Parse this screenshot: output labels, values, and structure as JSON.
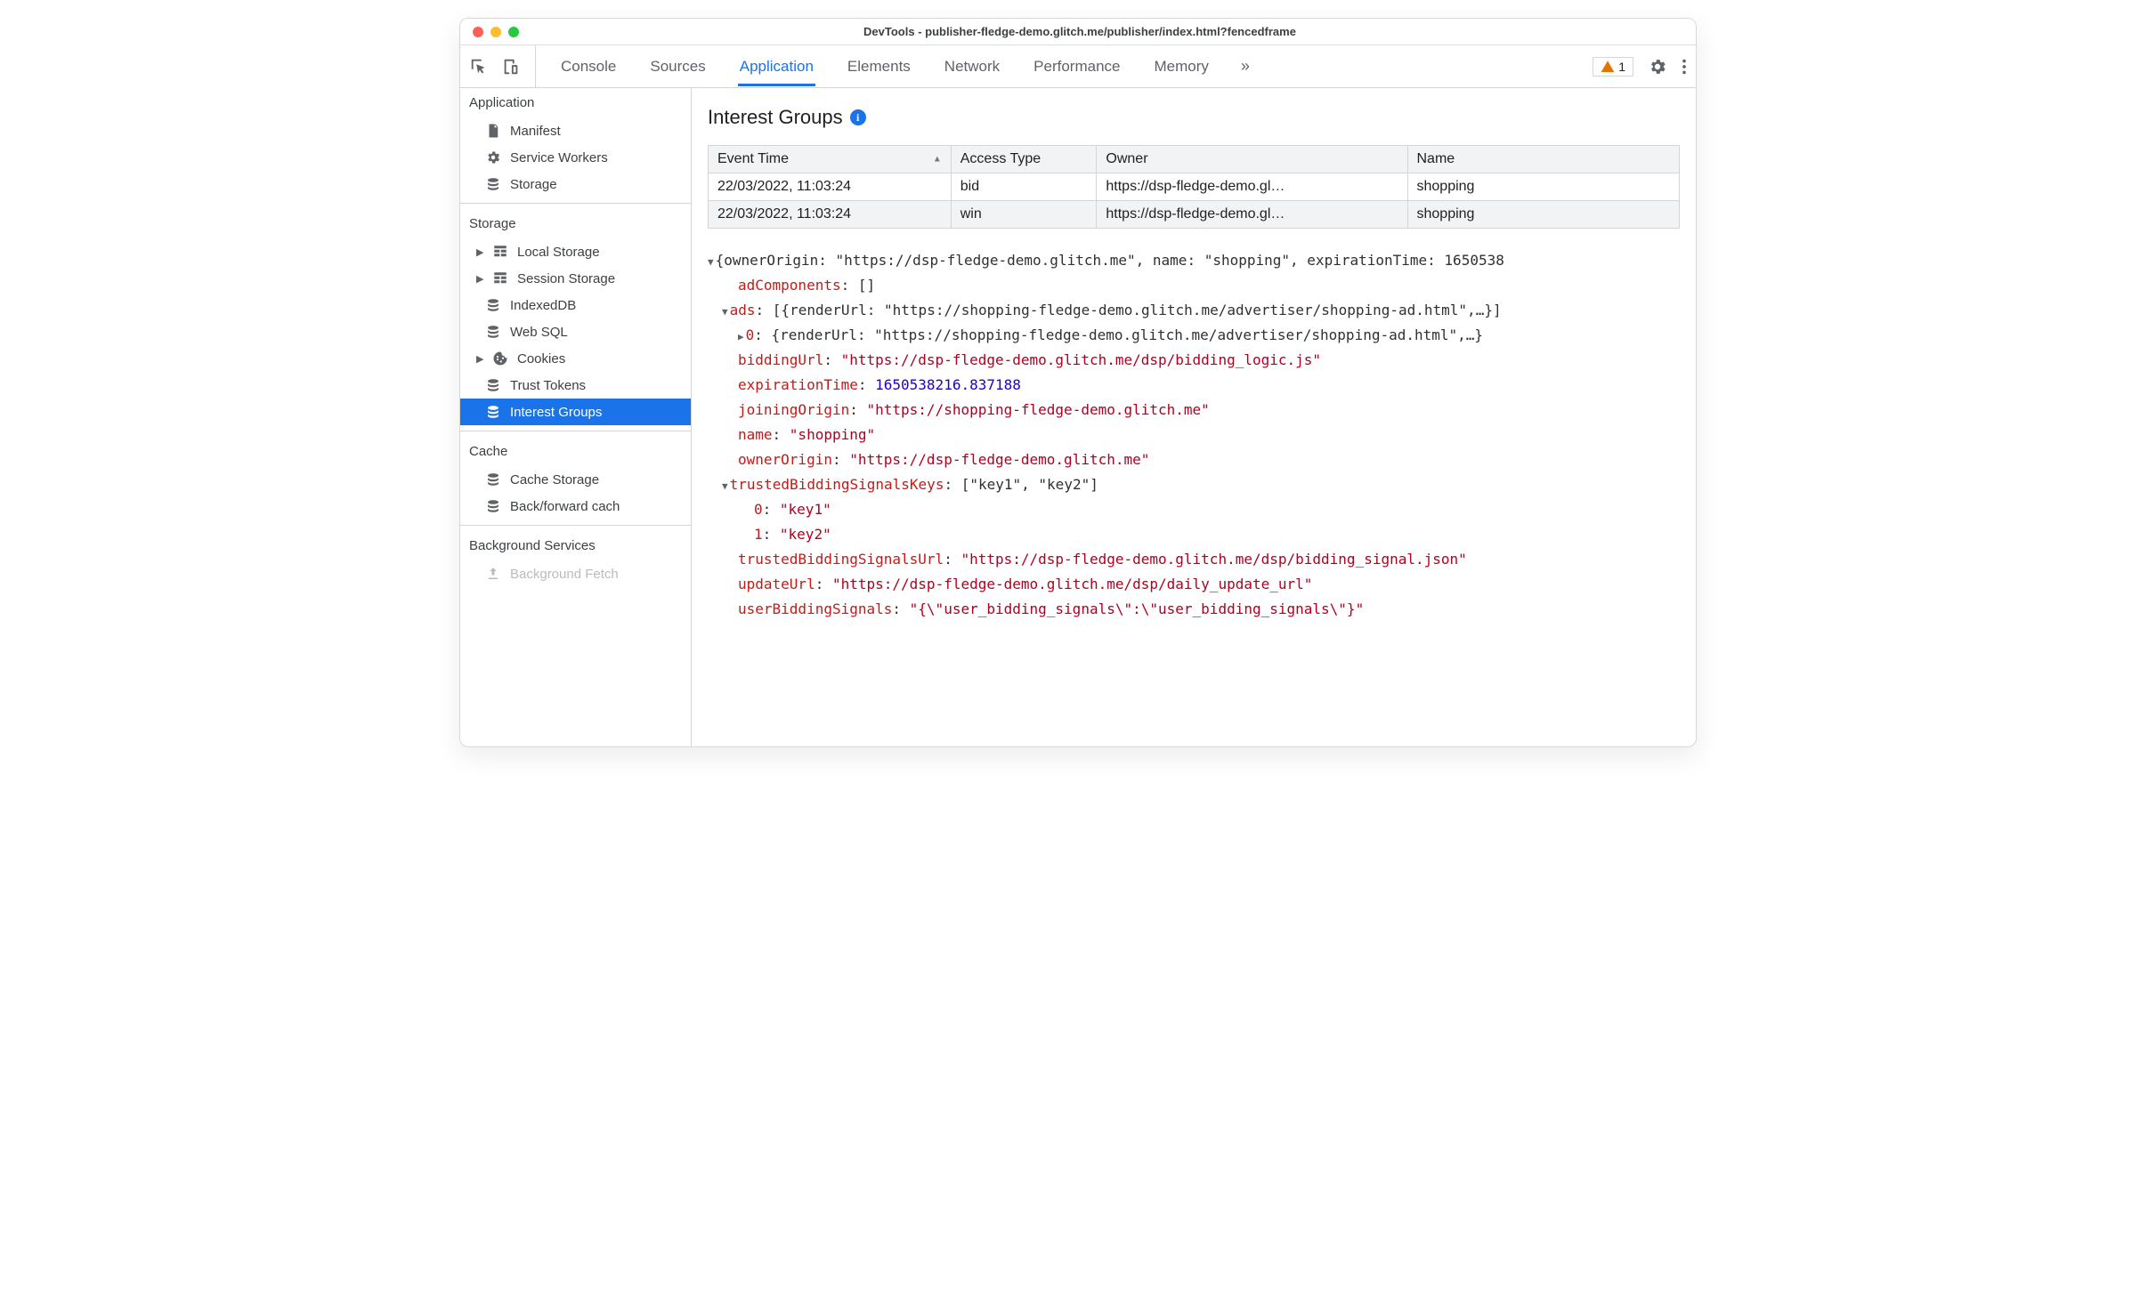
{
  "window": {
    "title": "DevTools - publisher-fledge-demo.glitch.me/publisher/index.html?fencedframe"
  },
  "tabs": {
    "items": [
      "Console",
      "Sources",
      "Application",
      "Elements",
      "Network",
      "Performance",
      "Memory"
    ],
    "activeIndex": 2,
    "overflow": "»",
    "warningCount": "1"
  },
  "sidebar": {
    "sectionApplication": "Application",
    "manifest": "Manifest",
    "serviceWorkers": "Service Workers",
    "storageApp": "Storage",
    "sectionStorage": "Storage",
    "localStorage": "Local Storage",
    "sessionStorage": "Session Storage",
    "indexedDB": "IndexedDB",
    "webSQL": "Web SQL",
    "cookies": "Cookies",
    "trustTokens": "Trust Tokens",
    "interestGroups": "Interest Groups",
    "sectionCache": "Cache",
    "cacheStorage": "Cache Storage",
    "backForwardCache": "Back/forward cach",
    "sectionBackground": "Background Services",
    "backgroundFetch": "Background Fetch"
  },
  "panel": {
    "title": "Interest Groups",
    "columns": [
      "Event Time",
      "Access Type",
      "Owner",
      "Name"
    ],
    "rows": [
      {
        "time": "22/03/2022, 11:03:24",
        "type": "bid",
        "owner": "https://dsp-fledge-demo.gl…",
        "name": "shopping"
      },
      {
        "time": "22/03/2022, 11:03:24",
        "type": "win",
        "owner": "https://dsp-fledge-demo.gl…",
        "name": "shopping"
      }
    ]
  },
  "json": {
    "headerPrefix": "{ownerOrigin: ",
    "headerOwner": "\"https://dsp-fledge-demo.glitch.me\"",
    "headerMid": ", name: ",
    "headerName": "\"shopping\"",
    "headerSuffix": ", expirationTime: ",
    "headerExp": "1650538",
    "adComponents_k": "adComponents",
    "adComponents_v": "[]",
    "ads_k": "ads",
    "ads_v": "[{renderUrl: \"https://shopping-fledge-demo.glitch.me/advertiser/shopping-ad.html\",…}]",
    "ads0_k": "0",
    "ads0_v": "{renderUrl: \"https://shopping-fledge-demo.glitch.me/advertiser/shopping-ad.html\",…}",
    "biddingUrl_k": "biddingUrl",
    "biddingUrl_v": "\"https://dsp-fledge-demo.glitch.me/dsp/bidding_logic.js\"",
    "expirationTime_k": "expirationTime",
    "expirationTime_v": "1650538216.837188",
    "joiningOrigin_k": "joiningOrigin",
    "joiningOrigin_v": "\"https://shopping-fledge-demo.glitch.me\"",
    "name_k": "name",
    "name_v": "\"shopping\"",
    "ownerOrigin_k": "ownerOrigin",
    "ownerOrigin_v": "\"https://dsp-fledge-demo.glitch.me\"",
    "tbsk_k": "trustedBiddingSignalsKeys",
    "tbsk_v": "[\"key1\", \"key2\"]",
    "tbsk0_k": "0",
    "tbsk0_v": "\"key1\"",
    "tbsk1_k": "1",
    "tbsk1_v": "\"key2\"",
    "tbsu_k": "trustedBiddingSignalsUrl",
    "tbsu_v": "\"https://dsp-fledge-demo.glitch.me/dsp/bidding_signal.json\"",
    "updateUrl_k": "updateUrl",
    "updateUrl_v": "\"https://dsp-fledge-demo.glitch.me/dsp/daily_update_url\"",
    "userBiddingSignals_k": "userBiddingSignals",
    "userBiddingSignals_v": "\"{\\\"user_bidding_signals\\\":\\\"user_bidding_signals\\\"}\""
  }
}
